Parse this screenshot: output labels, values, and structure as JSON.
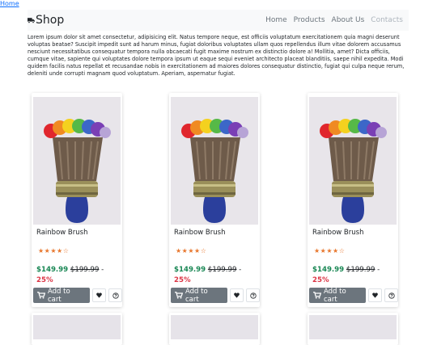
{
  "skip_link": "Home",
  "navbar": {
    "brand": "Shop",
    "links": [
      "Home",
      "Products",
      "About Us",
      "Contacts"
    ]
  },
  "intro": "Lorem ipsum dolor sit amet consectetur, adipisicing elit. Natus tempore neque, est officiis voluptatum exercitationem quia magni deserunt voluptas beatae? Suscipit impedit sunt ad harum minus, fugiat doloribus voluptates ullam quos repellendus illum vitae dolorem accusamus nesciunt necessitatibus consequatur tempora nulla obcaecati fugit maxime nostrum ex distinctio dolore a! Mollitia, amet? Dicta officiis, cumque vitae, sapiente qui voluptates dolore tempora ipsum ut eaque sequi eveniet architecto placeat blanditiis, saepe nihil expedita. Modi quidem facilis natus repellat et recusandae nobis in exercitationem ad maiores dolores consequatur distinctio, fugiat qui culpa neque rerum, deleniti unde corrupti magnam quod voluptatum. Aperiam, aspernatur fugiat.",
  "products": [
    {
      "title": "Rainbow Brush",
      "rating": 4.5,
      "stars": "★★★★☆",
      "price": "$149.99",
      "old_price": "$199.99",
      "separator": "-",
      "discount": "25%",
      "cart_label": "Add to cart"
    },
    {
      "title": "Rainbow Brush",
      "rating": 4.5,
      "stars": "★★★★☆",
      "price": "$149.99",
      "old_price": "$199.99",
      "separator": "-",
      "discount": "25%",
      "cart_label": "Add to cart"
    },
    {
      "title": "Rainbow Brush",
      "rating": 4.5,
      "stars": "★★★★☆",
      "price": "$149.99",
      "old_price": "$199.99",
      "separator": "-",
      "discount": "25%",
      "cart_label": "Add to cart"
    }
  ],
  "colors": {
    "price": "#198754",
    "discount": "#dc3545",
    "stars": "#e8772e",
    "cart_button": "#6c757d"
  },
  "icons": {
    "brand": "truck-icon",
    "cart": "cart-icon",
    "wishlist": "heart-icon",
    "info": "question-circle-icon"
  }
}
